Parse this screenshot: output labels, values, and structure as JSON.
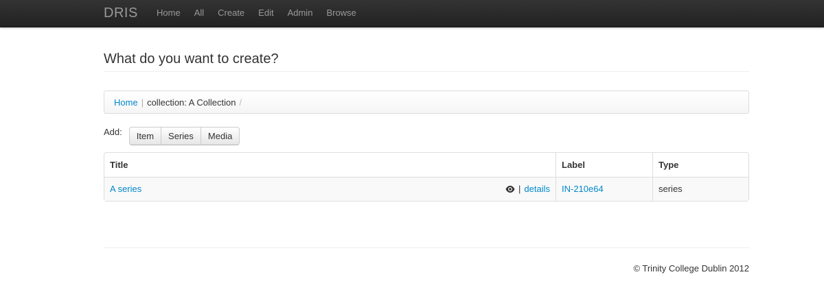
{
  "navbar": {
    "brand": "DRIS",
    "items": [
      {
        "label": "Home"
      },
      {
        "label": "All"
      },
      {
        "label": "Create"
      },
      {
        "label": "Edit"
      },
      {
        "label": "Admin"
      },
      {
        "label": "Browse"
      }
    ]
  },
  "page": {
    "title": "What do you want to create?"
  },
  "breadcrumb": {
    "home": "Home",
    "divider": "|",
    "current": "collection: A Collection",
    "trail": "/"
  },
  "add": {
    "label": "Add:",
    "buttons": [
      "Item",
      "Series",
      "Media"
    ]
  },
  "table": {
    "headers": [
      "Title",
      "Label",
      "Type"
    ],
    "rows": [
      {
        "title": "A series",
        "view_icon": "eye-icon",
        "separator": "|",
        "details": "details",
        "label": "IN-210e64",
        "type": "series"
      }
    ]
  },
  "footer": {
    "copyright": "© Trinity College Dublin 2012"
  },
  "colors": {
    "link": "#0088cc",
    "navbar": "#222222",
    "nav_text": "#999999"
  }
}
